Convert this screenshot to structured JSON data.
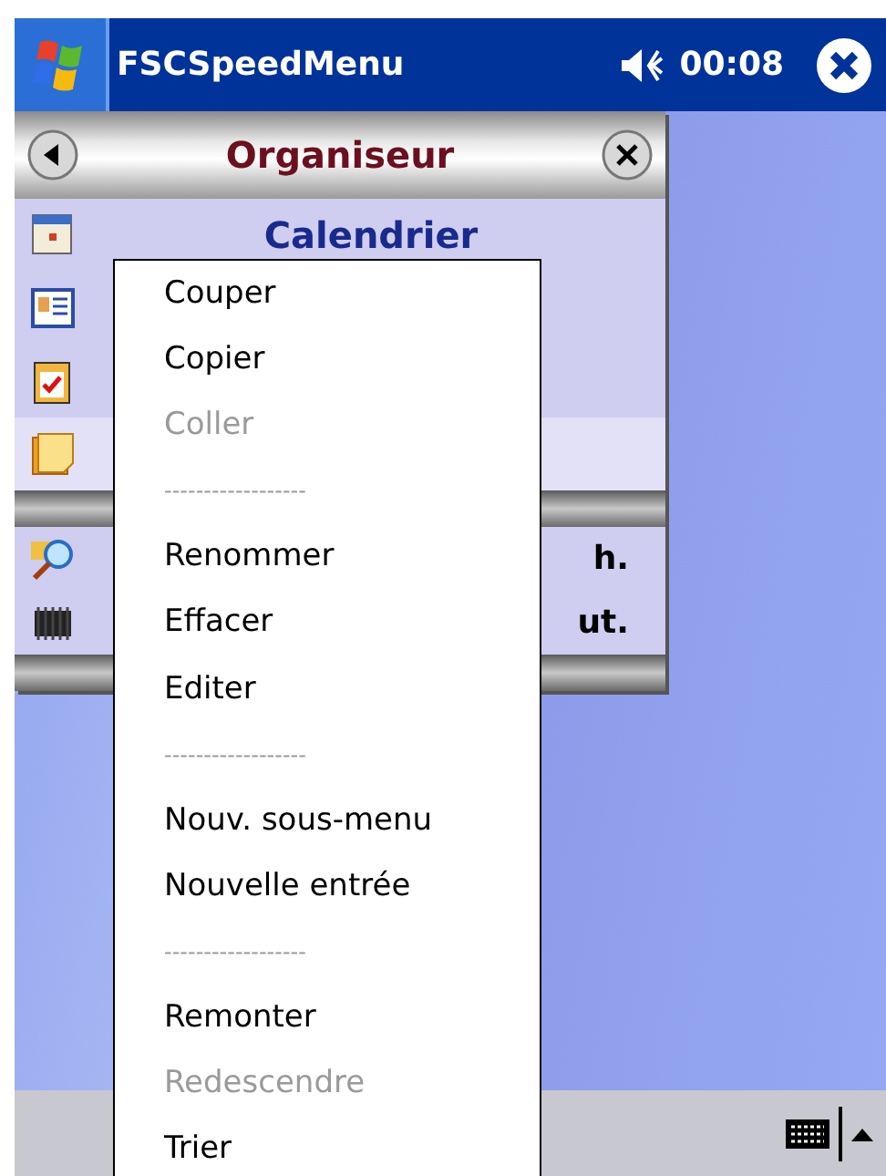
{
  "title_bar": {
    "title": "FSCSpeedMenu",
    "time": "00:08"
  },
  "panel": {
    "title": "Organiseur",
    "groups": [
      [
        {
          "kind": "calendar",
          "label": "Calendrier",
          "selected": false
        },
        {
          "kind": "contacts",
          "selected": false
        },
        {
          "kind": "tasks",
          "selected": false
        },
        {
          "kind": "notes",
          "selected": true
        }
      ],
      [
        {
          "kind": "search",
          "label": "h.",
          "selected": false
        },
        {
          "kind": "chip",
          "label": "ut.",
          "selected": false
        }
      ]
    ]
  },
  "context_menu": [
    {
      "kind": "item",
      "label": "Couper",
      "disabled": false
    },
    {
      "kind": "item",
      "label": "Copier",
      "disabled": false
    },
    {
      "kind": "item",
      "label": "Coller",
      "disabled": true
    },
    {
      "kind": "separator",
      "label": "------------------"
    },
    {
      "kind": "item",
      "label": "Renommer",
      "disabled": false
    },
    {
      "kind": "item",
      "label": "Effacer",
      "disabled": false
    },
    {
      "kind": "item",
      "label": "Editer",
      "disabled": false
    },
    {
      "kind": "separator",
      "label": "------------------"
    },
    {
      "kind": "item",
      "label": "Nouv. sous-menu",
      "disabled": false
    },
    {
      "kind": "item",
      "label": "Nouvelle entrée",
      "disabled": false
    },
    {
      "kind": "separator",
      "label": "------------------"
    },
    {
      "kind": "item",
      "label": "Remonter",
      "disabled": false
    },
    {
      "kind": "item",
      "label": "Redescendre",
      "disabled": true
    },
    {
      "kind": "item",
      "label": "Trier",
      "disabled": false
    }
  ]
}
